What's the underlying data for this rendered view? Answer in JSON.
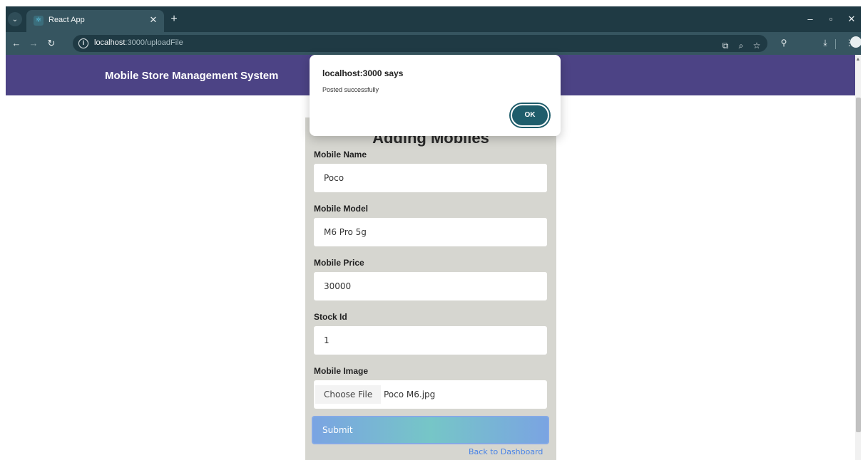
{
  "browser": {
    "tab_title": "React App",
    "url_host": "localhost",
    "url_rest": ":3000/uploadFile",
    "icons": [
      "tab-menu-icon",
      "react-favicon-icon",
      "close-icon",
      "plus-icon",
      "minimize-icon",
      "restore-icon",
      "back-icon",
      "forward-icon",
      "reload-icon",
      "info-icon",
      "install-icon",
      "zoom-icon",
      "star-icon",
      "extensions-icon",
      "download-icon",
      "profile-icon",
      "kebab-menu-icon"
    ]
  },
  "navbar": {
    "brand": "Mobile Store Management System",
    "color": "#4c4385"
  },
  "form": {
    "title": "Adding Mobiles",
    "fields": [
      {
        "label": "Mobile Name",
        "value": "Poco"
      },
      {
        "label": "Mobile Model",
        "value": "M6 Pro 5g"
      },
      {
        "label": "Mobile Price",
        "value": "30000"
      },
      {
        "label": "Stock Id",
        "value": "1"
      }
    ],
    "image": {
      "label": "Mobile Image",
      "button": "Choose File",
      "file_name": "Poco M6.jpg"
    },
    "submit": "Submit",
    "back_link": "Back to Dashboard",
    "card_color": "#d6d6d0"
  },
  "dialog": {
    "title": "localhost:3000 says",
    "message": "Posted successfully",
    "ok": "OK",
    "ok_color": "#1f5d6b"
  }
}
